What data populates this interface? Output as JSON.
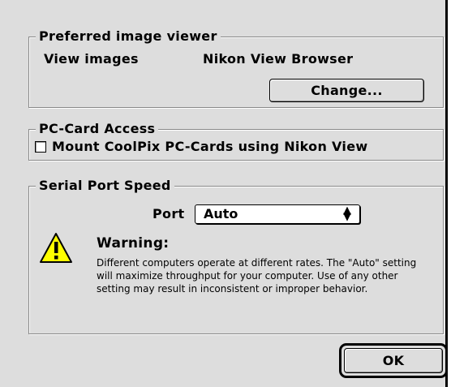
{
  "viewer": {
    "title": "Preferred image viewer",
    "label": "View images",
    "value": "Nikon View Browser",
    "change_button": "Change..."
  },
  "pccard": {
    "title": "PC-Card Access",
    "checkbox_label": "Mount CoolPix PC-Cards using Nikon View",
    "checked": false
  },
  "serial": {
    "title": "Serial Port Speed",
    "port_label": "Port",
    "port_value": "Auto",
    "warning_title": "Warning:",
    "warning_text": "Different computers operate at different rates.  The \"Auto\" setting will maximize throughput for your computer.  Use of any other setting may result in inconsistent or improper behavior."
  },
  "ok_button": "OK"
}
